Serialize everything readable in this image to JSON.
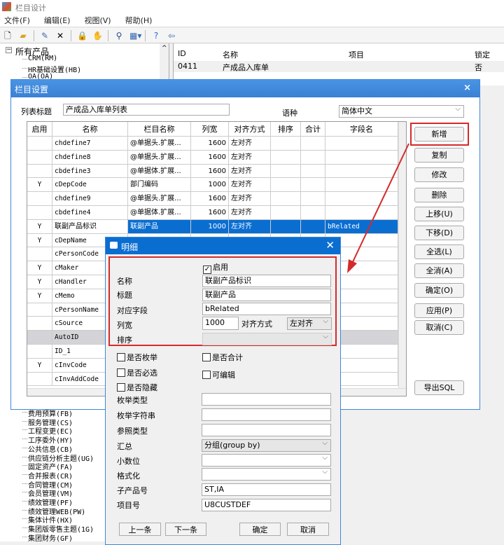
{
  "app": {
    "title": "栏目设计"
  },
  "menu": [
    "文件(F)",
    "编辑(E)",
    "视图(V)",
    "帮助(H)"
  ],
  "toolbar_icons": [
    "new-icon",
    "open-icon",
    "edit-icon",
    "delete-icon",
    "lock-icon",
    "unlock-icon",
    "find-icon",
    "layout-icon",
    "help-icon",
    "exit-icon"
  ],
  "tree": {
    "root": "所有产品",
    "top_items": [
      "CRM(RM)",
      "HR基础设置(HB)",
      "OA(OA)"
    ],
    "bottom_items": [
      "费用预算(FB)",
      "服务管理(CS)",
      "工程变更(EC)",
      "工序委外(HY)",
      "公共信息(CB)",
      "供应链分析主题(UG)",
      "固定资产(FA)",
      "合并报表(CR)",
      "合同管理(CM)",
      "会员管理(VM)",
      "绩效管理(PF)",
      "绩效管理WEB(PW)",
      "集体计件(HX)",
      "集团版零售主题(1G)",
      "集团财务(GF)"
    ]
  },
  "list": {
    "headers": [
      "ID",
      "名称",
      "项目",
      "锁定"
    ],
    "rows": [
      [
        "0411",
        "产成品入库单",
        "",
        "否"
      ]
    ]
  },
  "settings": {
    "title": "栏目设置",
    "list_title_label": "列表标题",
    "list_title_value": "产成品入库单列表",
    "language_label": "语种",
    "language_value": "简体中文",
    "headers": [
      "启用",
      "名称",
      "栏目名称",
      "列宽",
      "对齐方式",
      "排序",
      "合计",
      "字段名"
    ],
    "rows": [
      [
        "",
        "chdefine7",
        "@单据头.扩展...",
        "1600",
        "左对齐",
        "",
        "",
        ""
      ],
      [
        "",
        "chdefine8",
        "@单据头.扩展...",
        "1600",
        "左对齐",
        "",
        "",
        ""
      ],
      [
        "",
        "cbdefine3",
        "@单据体.扩展...",
        "1600",
        "左对齐",
        "",
        "",
        ""
      ],
      [
        "Y",
        "cDepCode",
        "部门编码",
        "1000",
        "左对齐",
        "",
        "",
        ""
      ],
      [
        "",
        "chdefine9",
        "@单据头.扩展...",
        "1600",
        "左对齐",
        "",
        "",
        ""
      ],
      [
        "",
        "cbdefine4",
        "@单据体.扩展...",
        "1600",
        "左对齐",
        "",
        "",
        ""
      ],
      [
        "Y",
        "联副产品标识",
        "联副产品",
        "1000",
        "左对齐",
        "",
        "",
        "bRelated"
      ],
      [
        "Y",
        "cDepName",
        "",
        "",
        "",
        "",
        "",
        ""
      ],
      [
        "",
        "cPersonCode",
        "",
        "",
        "",
        "",
        "",
        ""
      ],
      [
        "Y",
        "cMaker",
        "",
        "",
        "",
        "",
        "",
        ""
      ],
      [
        "Y",
        "cHandler",
        "",
        "",
        "",
        "",
        "",
        ""
      ],
      [
        "Y",
        "cMemo",
        "",
        "",
        "",
        "",
        "",
        ""
      ],
      [
        "",
        "cPersonName",
        "",
        "",
        "",
        "",
        "",
        ""
      ],
      [
        "",
        "cSource",
        "",
        "",
        "",
        "",
        "",
        ""
      ],
      [
        "",
        "AutoID",
        "",
        "",
        "",
        "",
        "",
        ""
      ],
      [
        "",
        "ID_1",
        "",
        "",
        "",
        "",
        "",
        ""
      ],
      [
        "Y",
        "cInvCode",
        "",
        "",
        "",
        "",
        "",
        ""
      ],
      [
        "",
        "cInvAddCode",
        "",
        "",
        "",
        "",
        "",
        ""
      ]
    ],
    "selected_row": 6,
    "buttons": [
      "新增",
      "复制",
      "修改",
      "删除",
      "上移(U)",
      "下移(D)",
      "全选(L)",
      "全消(A)",
      "确定(O)",
      "应用(P)",
      "取消(C)"
    ],
    "export_button": "导出SQL"
  },
  "detail": {
    "title": "明细",
    "enabled_label": "启用",
    "enabled": true,
    "name_label": "名称",
    "name_value": "联副产品标识",
    "caption_label": "标题",
    "caption_value": "联副产品",
    "field_label": "对应字段",
    "field_value": "bRelated",
    "width_label": "列宽",
    "width_value": "1000",
    "align_label": "对齐方式",
    "align_value": "左对齐",
    "sort_label": "排序",
    "sort_value": "",
    "cb_enum": "是否枚举",
    "cb_sum": "是否合计",
    "cb_required": "是否必选",
    "cb_editable": "可编辑",
    "cb_hidden": "是否隐藏",
    "enum_type_label": "枚举类型",
    "enum_type_value": "",
    "enum_string_label": "枚举字符串",
    "enum_string_value": "",
    "ref_type_label": "参照类型",
    "ref_type_value": "",
    "summary_label": "汇总",
    "summary_value": "分组(group by)",
    "decimals_label": "小数位",
    "decimals_value": "",
    "format_label": "格式化",
    "format_value": "",
    "subproduct_label": "子产品号",
    "subproduct_value": "ST,IA",
    "item_label": "项目号",
    "item_value": "U8CUSTDEF",
    "prev": "上一条",
    "next": "下一条",
    "ok": "确定",
    "cancel": "取消"
  },
  "colors": {
    "accent": "#0a6ed1",
    "titlebar": "#3c87d8",
    "annotation": "#d42a2a"
  }
}
